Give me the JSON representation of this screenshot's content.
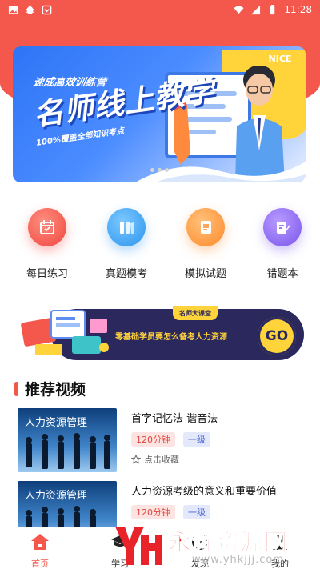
{
  "status_bar": {
    "time": "11:28"
  },
  "colors": {
    "primary": "#f4574c",
    "banner_blue": "#2e74f6",
    "promo_navy": "#2b285e",
    "promo_yellow": "#ffd43b"
  },
  "banner": {
    "subtitle": "速成高效训练营",
    "title": "名师线上教学",
    "caption": "100%覆盖全部知识考点",
    "corner": "NICE"
  },
  "quick_actions": [
    {
      "label": "每日练习",
      "icon": "calendar-icon"
    },
    {
      "label": "真题模考",
      "icon": "books-icon"
    },
    {
      "label": "模拟试题",
      "icon": "document-icon"
    },
    {
      "label": "错题本",
      "icon": "edit-notebook-icon"
    }
  ],
  "promo": {
    "tag": "名师大课堂",
    "text": "零基础学员要怎么备考人力资源",
    "cta": "GO"
  },
  "section": {
    "title": "推荐视频"
  },
  "videos": [
    {
      "thumb_text": "人力资源管理",
      "title": "首字记忆法 谐音法",
      "duration": "120分钟",
      "level": "一级",
      "fav_label": "点击收藏"
    },
    {
      "thumb_text": "人力资源管理",
      "title": "人力资源考级的意义和重要价值",
      "duration": "120分钟",
      "level": "一级"
    }
  ],
  "tabs": [
    {
      "label": "首页",
      "icon": "home-icon",
      "active": true
    },
    {
      "label": "学习",
      "icon": "graduation-cap-icon",
      "active": false
    },
    {
      "label": "发现",
      "icon": "compass-icon",
      "active": false
    },
    {
      "label": "我的",
      "icon": "user-icon",
      "active": false
    }
  ],
  "watermark": {
    "title": "永辉资源网",
    "url": "www.yhkjjj.com"
  }
}
